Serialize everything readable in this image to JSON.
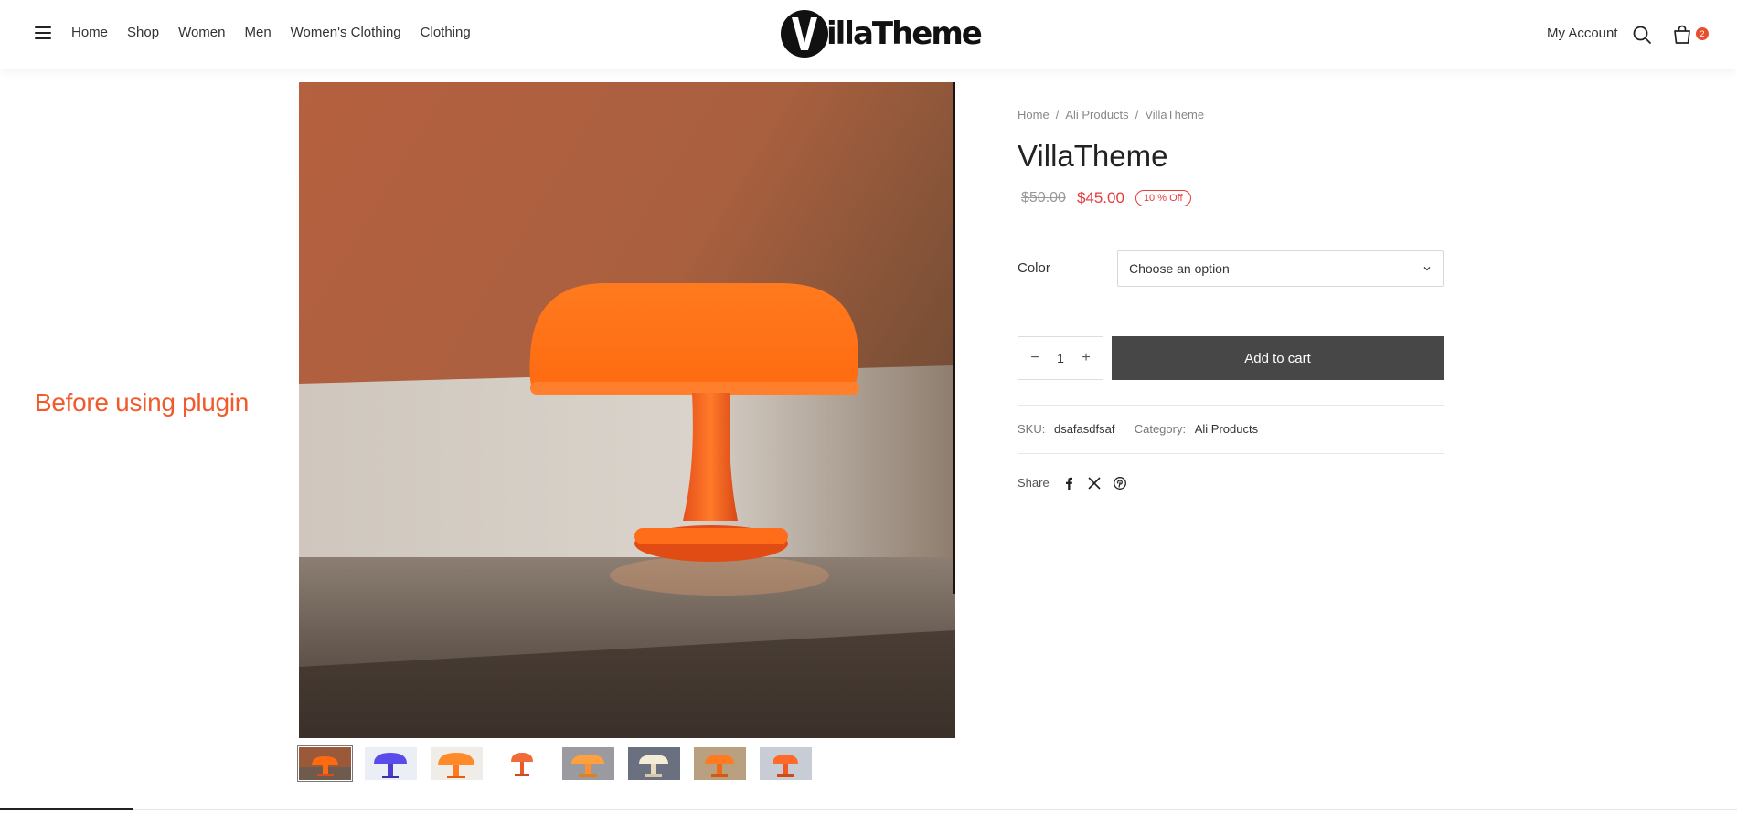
{
  "header": {
    "nav": [
      "Home",
      "Shop",
      "Women",
      "Men",
      "Women's Clothing",
      "Clothing"
    ],
    "logo_text": "illaTheme",
    "logo_letter": "V",
    "account_label": "My Account",
    "cart_count": "2"
  },
  "annotation": {
    "label": "Before using plugin",
    "color": "#f15a2b"
  },
  "gallery": {
    "main_image": "orange-mushroom-lamp",
    "thumbnails": [
      "orange-lamp",
      "blue-lamp",
      "orange-lamp-2",
      "red-lamp",
      "orange-lamp-3",
      "white-lamp",
      "orange-lamp-4",
      "orange-lamp-5"
    ]
  },
  "product": {
    "breadcrumb": [
      "Home",
      "Ali Products",
      "VillaTheme"
    ],
    "breadcrumb_sep": "/",
    "title": "VillaTheme",
    "old_price": "$50.00",
    "new_price": "$45.00",
    "discount": "10 % Off",
    "color_label": "Color",
    "color_select_value": "Choose an option",
    "quantity": "1",
    "qty_minus": "−",
    "qty_plus": "+",
    "add_to_cart": "Add to cart",
    "sku_label": "SKU:",
    "sku_value": "dsafasdfsaf",
    "category_label": "Category:",
    "category_value": "Ali Products",
    "share_label": "Share"
  },
  "colors": {
    "accent_red": "#e53b3b",
    "button_dark": "#474747",
    "badge": "#e8502c"
  }
}
